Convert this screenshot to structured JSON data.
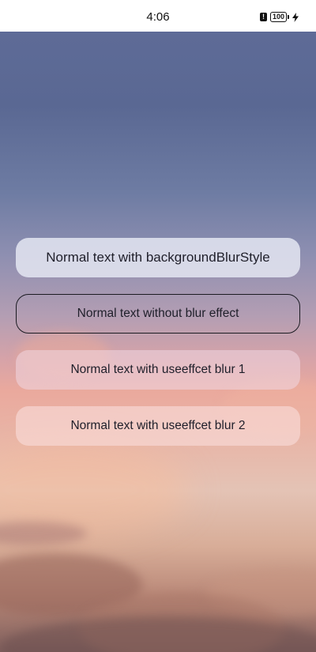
{
  "status_bar": {
    "time": "4:06",
    "battery_level": "100",
    "icons": [
      "alert-icon",
      "battery-icon",
      "charging-icon"
    ]
  },
  "background": {
    "description_colors": [
      "#5e6b97",
      "#b49eb3",
      "#eaa99d",
      "#e4c3b5",
      "#7e5e5c"
    ]
  },
  "buttons": [
    {
      "label": "Normal text with backgroundBlurStyle"
    },
    {
      "label": "Normal text without blur effect"
    },
    {
      "label": "Normal text with useeffcet blur 1"
    },
    {
      "label": "Normal text with useeffcet blur 2"
    }
  ]
}
